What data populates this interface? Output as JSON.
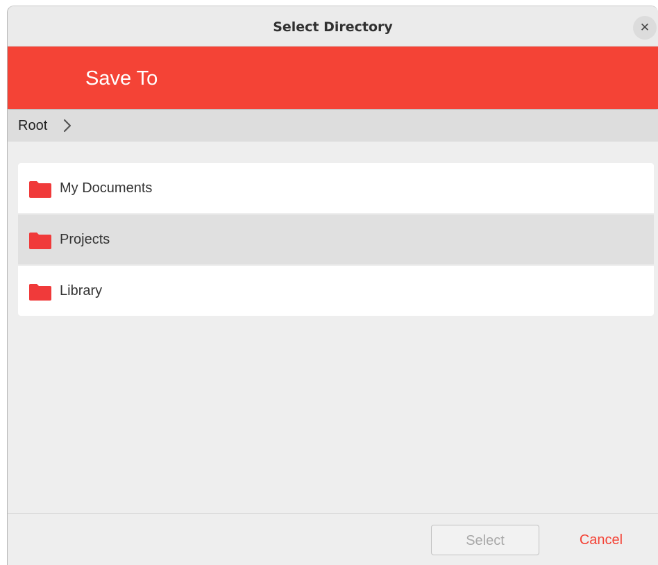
{
  "window": {
    "title": "Select Directory",
    "close_icon": "close-icon"
  },
  "header": {
    "title": "Save To",
    "color": "#f44336"
  },
  "breadcrumb": {
    "items": [
      "Root"
    ],
    "separator_icon": "chevron-right-icon"
  },
  "folders": [
    {
      "label": "My Documents",
      "icon": "folder-icon",
      "hovered": false
    },
    {
      "label": "Projects",
      "icon": "folder-icon",
      "hovered": true
    },
    {
      "label": "Library",
      "icon": "folder-icon",
      "hovered": false
    }
  ],
  "folder_icon_color": "#f03a3a",
  "footer": {
    "select_label": "Select",
    "select_enabled": false,
    "cancel_label": "Cancel",
    "cancel_color": "#f44336"
  }
}
